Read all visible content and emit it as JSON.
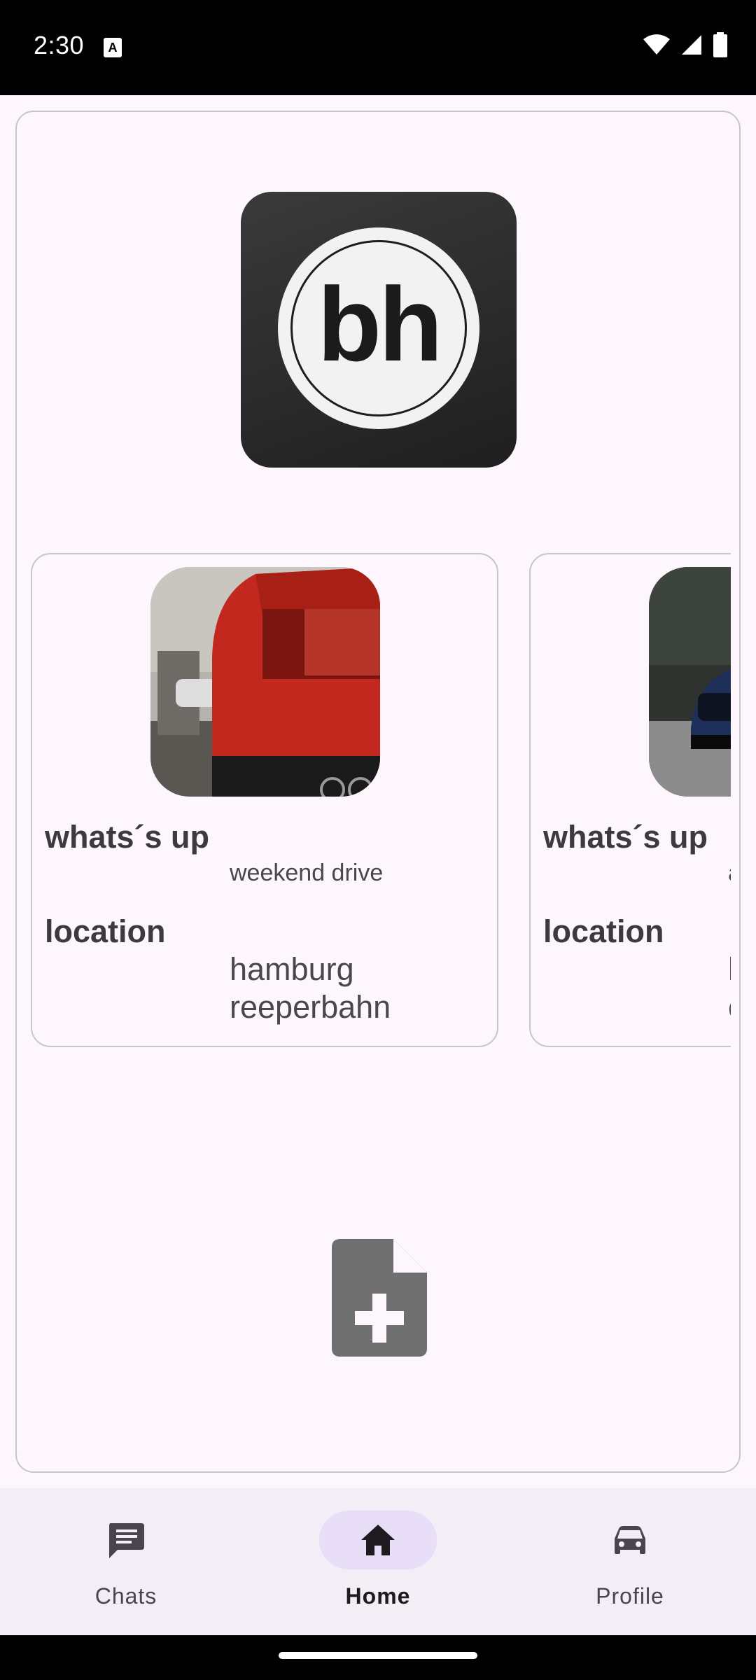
{
  "status_bar": {
    "time": "2:30",
    "notification_icon": "A",
    "icons": [
      "wifi-icon",
      "signal-icon",
      "battery-icon"
    ]
  },
  "logo": {
    "text": "bh"
  },
  "posts": [
    {
      "status_label": "whats´s up",
      "status_value": "weekend drive",
      "location_label": "location",
      "location_value": "hamburg reeperbahn",
      "image": "red-car-rear-photo"
    },
    {
      "status_label": "whats´s up",
      "status_value": "a",
      "location_label": "location",
      "location_value": "l\nc",
      "image": "blue-car-front-photo"
    }
  ],
  "add_button": {
    "icon": "add-document-icon"
  },
  "nav": {
    "items": [
      {
        "label": "Chats",
        "icon": "chat-icon",
        "active": false
      },
      {
        "label": "Home",
        "icon": "home-icon",
        "active": true
      },
      {
        "label": "Profile",
        "icon": "car-icon",
        "active": false
      }
    ]
  },
  "colors": {
    "background": "#fdf7fd",
    "nav_background": "#f3edf6",
    "nav_active_pill": "#e8def8",
    "border": "#c9c3ca"
  }
}
